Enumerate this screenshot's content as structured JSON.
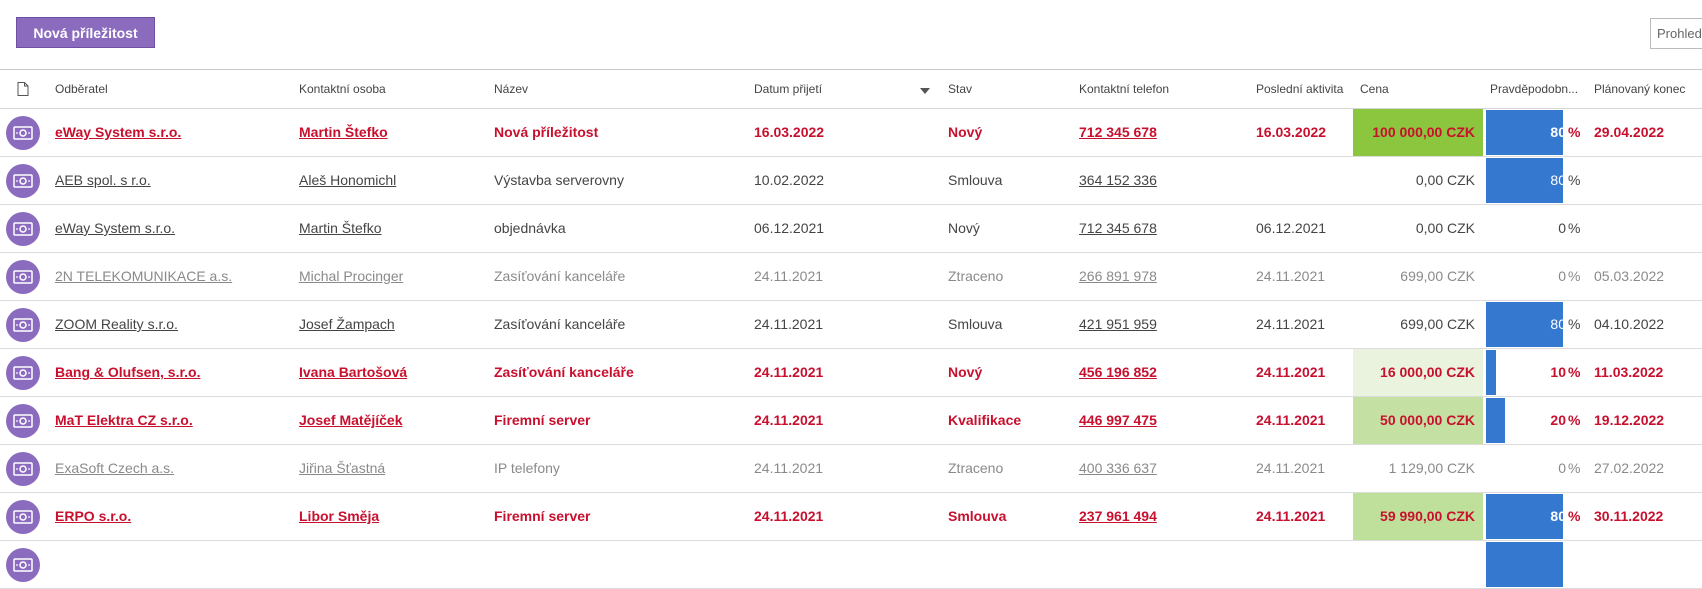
{
  "toolbar": {
    "new_button_label": "Nová příležitost",
    "search_placeholder": "Prohledat"
  },
  "colors": {
    "accent": "#8b6bbd",
    "hot_text": "#c8102e",
    "probability_bar": "#3578cf",
    "price_high": "#8cc63f",
    "price_mid": "#c5e0a3",
    "price_low": "#e9f3dd"
  },
  "columns": {
    "document_icon": "document-icon",
    "customer": "Odběratel",
    "contact": "Kontaktní osoba",
    "name": "Název",
    "received": "Datum přijetí",
    "status": "Stav",
    "phone": "Kontaktní telefon",
    "last_activity": "Poslední aktivita",
    "price": "Cena",
    "probability": "Pravděpodobn...",
    "planned_end": "Plánovaný konec"
  },
  "rows": [
    {
      "style": "hot",
      "customer": "eWay System s.r.o.",
      "contact": "Martin Štefko",
      "name": "Nová příležitost",
      "received": "16.03.2022",
      "status": "Nový",
      "phone": "712 345 678",
      "last_activity": "16.03.2022",
      "price": "100 000,00 CZK",
      "price_tint": "#8cc63f",
      "probability": 80,
      "prob_label": "80",
      "pct": "%",
      "planned_end": "29.04.2022"
    },
    {
      "style": "normal",
      "customer": "AEB spol. s r.o.",
      "contact": "Aleš Honomichl",
      "name": "Výstavba serverovny",
      "received": "10.02.2022",
      "status": "Smlouva",
      "phone": "364 152 336",
      "last_activity": "",
      "price": "0,00 CZK",
      "price_tint": "",
      "probability": 80,
      "prob_label": "80",
      "pct": "%",
      "planned_end": ""
    },
    {
      "style": "normal",
      "customer": "eWay System s.r.o.",
      "contact": "Martin Štefko",
      "name": "objednávka",
      "received": "06.12.2021",
      "status": "Nový",
      "phone": "712 345 678",
      "last_activity": "06.12.2021",
      "price": "0,00 CZK",
      "price_tint": "",
      "probability": 0,
      "prob_label": "0",
      "pct": "%",
      "planned_end": ""
    },
    {
      "style": "lost",
      "customer": "2N TELEKOMUNIKACE a.s.",
      "contact": "Michal Procinger",
      "name": "Zasíťování kanceláře",
      "received": "24.11.2021",
      "status": "Ztraceno",
      "phone": "266 891 978",
      "last_activity": "24.11.2021",
      "price": "699,00 CZK",
      "price_tint": "",
      "probability": 0,
      "prob_label": "0",
      "pct": "%",
      "planned_end": "05.03.2022"
    },
    {
      "style": "normal",
      "customer": "ZOOM Reality s.r.o.",
      "contact": "Josef Žampach",
      "name": "Zasíťování kanceláře",
      "received": "24.11.2021",
      "status": "Smlouva",
      "phone": "421 951 959",
      "last_activity": "24.11.2021",
      "price": "699,00 CZK",
      "price_tint": "",
      "probability": 80,
      "prob_label": "80",
      "pct": "%",
      "planned_end": "04.10.2022"
    },
    {
      "style": "hot",
      "customer": "Bang & Olufsen, s.r.o.",
      "contact": "Ivana Bartošová",
      "name": "Zasíťování kanceláře",
      "received": "24.11.2021",
      "status": "Nový",
      "phone": "456 196 852",
      "last_activity": "24.11.2021",
      "price": "16 000,00 CZK",
      "price_tint": "#e9f3dd",
      "probability": 10,
      "prob_label": "10",
      "pct": "%",
      "planned_end": "11.03.2022"
    },
    {
      "style": "hot",
      "customer": "MaT Elektra CZ s.r.o.",
      "contact": "Josef Matějíček",
      "name": "Firemní server",
      "received": "24.11.2021",
      "status": "Kvalifikace",
      "phone": "446 997 475",
      "last_activity": "24.11.2021",
      "price": "50 000,00 CZK",
      "price_tint": "#c5e0a3",
      "probability": 20,
      "prob_label": "20",
      "pct": "%",
      "planned_end": "19.12.2022"
    },
    {
      "style": "lost",
      "customer": "ExaSoft Czech a.s.",
      "contact": "Jiřina Šťastná",
      "name": "IP telefony",
      "received": "24.11.2021",
      "status": "Ztraceno",
      "phone": "400 336 637",
      "last_activity": "24.11.2021",
      "price": "1 129,00 CZK",
      "price_tint": "",
      "probability": 0,
      "prob_label": "0",
      "pct": "%",
      "planned_end": "27.02.2022"
    },
    {
      "style": "hot",
      "customer": "ERPO s.r.o.",
      "contact": "Libor Směja",
      "name": "Firemní server",
      "received": "24.11.2021",
      "status": "Smlouva",
      "phone": "237 961 494",
      "last_activity": "24.11.2021",
      "price": "59 990,00 CZK",
      "price_tint": "#bfe09a",
      "probability": 80,
      "prob_label": "80",
      "pct": "%",
      "planned_end": "30.11.2022"
    },
    {
      "style": "normal",
      "customer": "",
      "contact": "",
      "name": "",
      "received": "",
      "status": "",
      "phone": "",
      "last_activity": "",
      "price": "",
      "price_tint": "",
      "probability": 80,
      "prob_label": "",
      "pct": "",
      "planned_end": ""
    }
  ]
}
